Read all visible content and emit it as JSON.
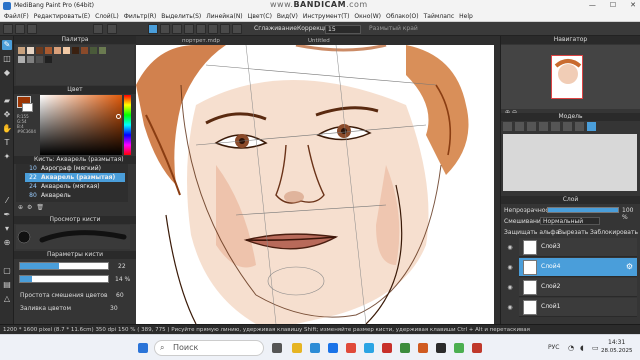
{
  "window": {
    "title": "MediBang Paint Pro (64bit)",
    "controls": [
      "—",
      "☐",
      "✕"
    ]
  },
  "watermark": {
    "prefix": "www.",
    "brand": "BANDICAM",
    "suffix": ".com"
  },
  "menu": [
    "Файл(F)",
    "Редактировать(E)",
    "Слой(L)",
    "Фильтр(R)",
    "Выделить(S)",
    "Линейка(N)",
    "Цвет(C)",
    "Вид(V)",
    "Инструмент(T)",
    "Окно(W)",
    "Облако(O)",
    "Таймлапс",
    "Help"
  ],
  "toolbar": {
    "smoothing_label": "Сглаживание",
    "correction_label": "Коррекция",
    "correction_value": "15",
    "snap_label": "Размытый край"
  },
  "tabs": [
    {
      "label": "портрет.mdp"
    },
    {
      "label": "Untitled"
    }
  ],
  "left": {
    "palette_title": "Палитра",
    "color_title": "Цвет",
    "color_values": {
      "r": "R:155",
      "g": "G:54",
      "b": "B:4",
      "hex": "#9C3604"
    },
    "brush_title": "Кисть: Акварель (размытая)",
    "brushes": [
      {
        "size": "10",
        "name": "Аэрограф (мягкий)"
      },
      {
        "size": "22",
        "name": "Акварель (размытая)",
        "selected": true
      },
      {
        "size": "24",
        "name": "Акварель (мягкая)"
      },
      {
        "size": "80",
        "name": "Акварель"
      }
    ],
    "preview_title": "Просмотр кисти",
    "params_title": "Параметры кисти",
    "param_size": "22",
    "param_opacity": "14 %",
    "mix_label": "Простота смешения цветов",
    "mix_value": "60",
    "fill_label": "Заливка цветом",
    "fill_value": "30"
  },
  "right": {
    "navigator_title": "Навигатор",
    "model_title": "Модель",
    "layer_title": "Слой",
    "opacity_label": "Непрозрачность",
    "opacity_value": "100 %",
    "blend_label": "Смешивание",
    "blend_value": "Нормальный",
    "checks": [
      "Защищать альфа",
      "Вырезать",
      "Заблокировать"
    ],
    "layers": [
      {
        "name": "Слой3",
        "selected": false
      },
      {
        "name": "Слой4",
        "selected": true
      },
      {
        "name": "Слой2",
        "selected": false
      },
      {
        "name": "Слой1",
        "selected": false
      }
    ]
  },
  "status": {
    "canvas": "1200 * 1600 pixel",
    "size_cm": "(8.7 * 11.6cm)",
    "dpi": "350 dpi",
    "zoom": "150 %",
    "coords": "( 389, 775 )",
    "hint": "Рисуйте прямую линию, удерживая клавишу Shift; изменяйте размер кисти, удерживая клавиши Ctrl + Alt и перетаскивая"
  },
  "taskbar": {
    "search_placeholder": "Поиск",
    "lang": "РУС",
    "time": "14:31",
    "date": "28.05.2025"
  },
  "colors": {
    "accent": "#4a9eda",
    "main_color": "#9c3604"
  }
}
